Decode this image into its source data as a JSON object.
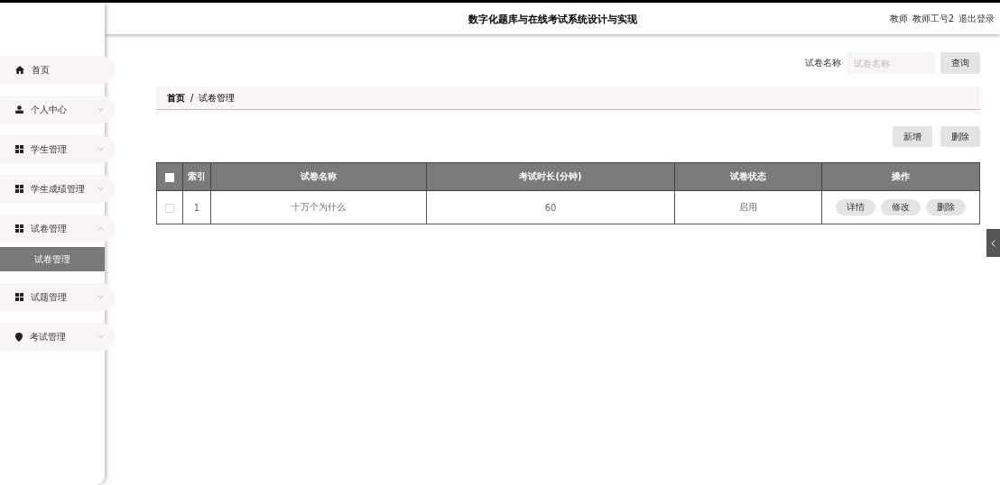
{
  "header": {
    "title": "数字化题库与在线考试系统设计与实现",
    "user_role": "教师",
    "user_name": "教师工号2",
    "logout": "退出登录"
  },
  "sidebar": {
    "items": [
      {
        "label": "首页",
        "kind": "home"
      },
      {
        "label": "个人中心",
        "kind": "user",
        "expanded": false
      },
      {
        "label": "学生管理",
        "kind": "grid",
        "expanded": false
      },
      {
        "label": "学生成绩管理",
        "kind": "grid",
        "expanded": false
      },
      {
        "label": "试卷管理",
        "kind": "grid",
        "expanded": true,
        "children": [
          {
            "label": "试卷管理",
            "selected": true
          }
        ]
      },
      {
        "label": "试题管理",
        "kind": "grid",
        "expanded": false
      },
      {
        "label": "考试管理",
        "kind": "pin",
        "expanded": false
      }
    ]
  },
  "search": {
    "label": "试卷名称",
    "placeholder": "试卷名称",
    "button": "查询"
  },
  "breadcrumb": {
    "separator": "/",
    "items": [
      "首页",
      "试卷管理"
    ]
  },
  "actions": [
    "新增",
    "删除"
  ],
  "table": {
    "columns": [
      "索引",
      "试卷名称",
      "考试时长(分钟)",
      "试卷状态",
      "操作"
    ],
    "all_checked": false,
    "rows": [
      {
        "checked": false,
        "cells": [
          "1",
          "十万个为什么",
          "60",
          "启用"
        ],
        "actions": [
          "详情",
          "修改",
          "删除"
        ]
      }
    ]
  }
}
